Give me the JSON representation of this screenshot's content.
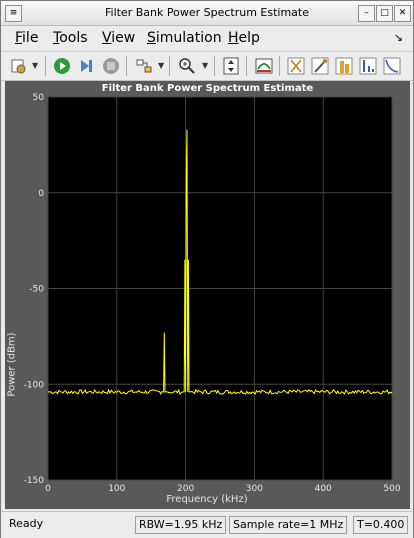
{
  "window": {
    "title": "Filter Bank Power Spectrum Estimate"
  },
  "menu": [
    "File",
    "Tools",
    "View",
    "Simulation",
    "Help"
  ],
  "menu_mnemonic": [
    "F",
    "T",
    "V",
    "S",
    "H"
  ],
  "toolbar": {
    "buttons": [
      "settings-icon",
      "run-icon",
      "step-forward-icon",
      "stop-icon",
      "highlight-signal-icon",
      "zoom-in-icon",
      "scale-axes-icon",
      "spectrum-settings-icon",
      "cursor-measurements-icon",
      "peak-finder-icon",
      "channel-measurements-icon",
      "distortion-measurements-icon",
      "ccdf-icon"
    ]
  },
  "status": {
    "state": "Ready",
    "rbw": "RBW=1.95 kHz",
    "sample_rate": "Sample rate=1 MHz",
    "time": "T=0.400"
  },
  "colors": {
    "background": "#000000",
    "trace": "#ffff00",
    "grid": "#444444",
    "frame": "#595959"
  },
  "chart_data": {
    "type": "line",
    "title": "Filter Bank Power Spectrum Estimate",
    "xlabel": "Frequency (kHz)",
    "ylabel": "Power (dBm)",
    "xlim": [
      0,
      500
    ],
    "ylim": [
      -150,
      50
    ],
    "xticks": [
      0,
      100,
      200,
      300,
      400,
      500
    ],
    "yticks": [
      50,
      0,
      -50,
      -100,
      -150
    ],
    "grid": true,
    "noise_floor_dbm": -104,
    "series": [
      {
        "x": [
          0,
          165,
          168,
          169,
          170,
          171,
          174,
          196,
          198,
          199,
          200,
          201,
          202,
          203,
          204,
          205,
          207,
          500
        ],
        "y": [
          -104,
          -104,
          -104,
          -73,
          -104,
          -104,
          -104,
          -104,
          -104,
          -35,
          -104,
          10,
          33,
          -104,
          -35,
          -104,
          -104,
          -104
        ]
      }
    ]
  }
}
